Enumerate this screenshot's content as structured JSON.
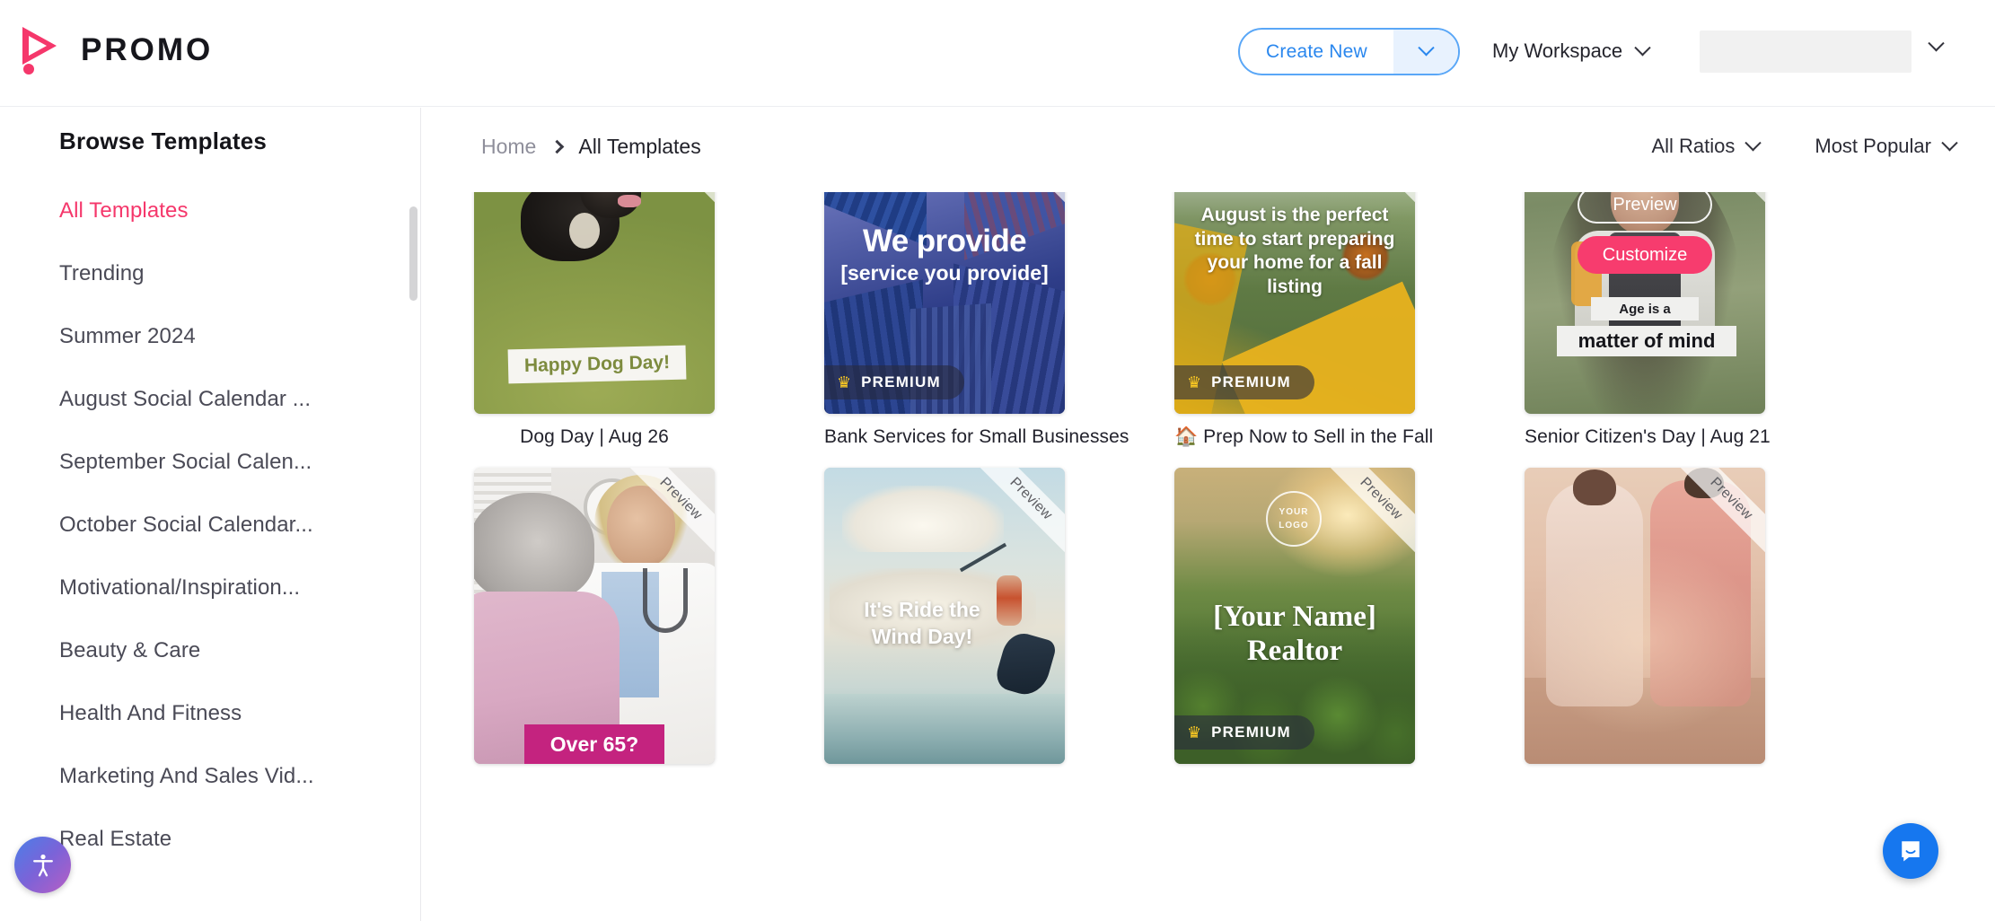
{
  "brand": {
    "name": "PROMO",
    "accent": "#f5376b",
    "logo_icon": "play-triangle-icon"
  },
  "header": {
    "create_new_label": "Create New",
    "create_new_caret_icon": "chevron-down-icon",
    "workspace_label": "My Workspace",
    "workspace_caret_icon": "chevron-down-icon",
    "account_caret_icon": "chevron-down-icon",
    "account_value": ""
  },
  "sidebar": {
    "title": "Browse Templates",
    "items": [
      {
        "label": "All Templates",
        "active": true
      },
      {
        "label": "Trending",
        "active": false
      },
      {
        "label": "Summer 2024",
        "active": false
      },
      {
        "label": "August Social Calendar ...",
        "active": false
      },
      {
        "label": "September Social Calen...",
        "active": false
      },
      {
        "label": "October Social Calendar...",
        "active": false
      },
      {
        "label": "Motivational/Inspiration...",
        "active": false
      },
      {
        "label": "Beauty & Care",
        "active": false
      },
      {
        "label": "Health And Fitness",
        "active": false
      },
      {
        "label": "Marketing And Sales Vid...",
        "active": false
      },
      {
        "label": "Real Estate",
        "active": false
      }
    ],
    "accessibility_icon": "accessibility-person-icon"
  },
  "toolbar": {
    "breadcrumb": {
      "home": "Home",
      "separator_icon": "chevron-right-icon",
      "current": "All Templates"
    },
    "filters": [
      {
        "label": "All Ratios",
        "icon": "chevron-down-icon"
      },
      {
        "label": "Most Popular",
        "icon": "chevron-down-icon"
      }
    ]
  },
  "grid": {
    "ribbon_label": "Preview",
    "premium_label": "PREMIUM",
    "premium_icon": "crown-icon",
    "hover": {
      "preview_label": "Preview",
      "customize_label": "Customize",
      "customize_color": "#f73c6e"
    },
    "cards": [
      {
        "art": "dog",
        "caption": "Dog Day | Aug 26",
        "overlay_lines": [
          "Happy Dog Day!"
        ],
        "premium": false,
        "hovered": false
      },
      {
        "art": "bank",
        "caption": "Bank Services for Small Businesses",
        "overlay_lines": [
          "We provide",
          "[service you provide]"
        ],
        "premium": true,
        "hovered": false
      },
      {
        "art": "fall",
        "caption": "🏠 Prep Now to Sell in the Fall",
        "overlay_lines": [
          "August is the perfect time to start preparing your home for a fall listing"
        ],
        "premium": true,
        "hovered": false
      },
      {
        "art": "senior",
        "caption": "Senior Citizen's Day | Aug 21",
        "overlay_lines": [
          "Age is a",
          "matter of mind"
        ],
        "premium": false,
        "hovered": true
      },
      {
        "art": "doctor",
        "caption": "",
        "overlay_lines": [
          "Over 65?"
        ],
        "premium": false,
        "hovered": false
      },
      {
        "art": "wind",
        "caption": "",
        "overlay_lines": [
          "It's Ride the Wind Day!"
        ],
        "premium": false,
        "hovered": false
      },
      {
        "art": "realtor",
        "caption": "",
        "overlay_lines": [
          "YOUR",
          "LOGO",
          "[Your Name]",
          "Realtor"
        ],
        "premium": true,
        "hovered": false
      },
      {
        "art": "beach",
        "caption": "",
        "overlay_lines": [],
        "premium": false,
        "hovered": false
      }
    ]
  },
  "chat": {
    "icon": "chat-bubble-icon",
    "color": "#1677ef"
  }
}
